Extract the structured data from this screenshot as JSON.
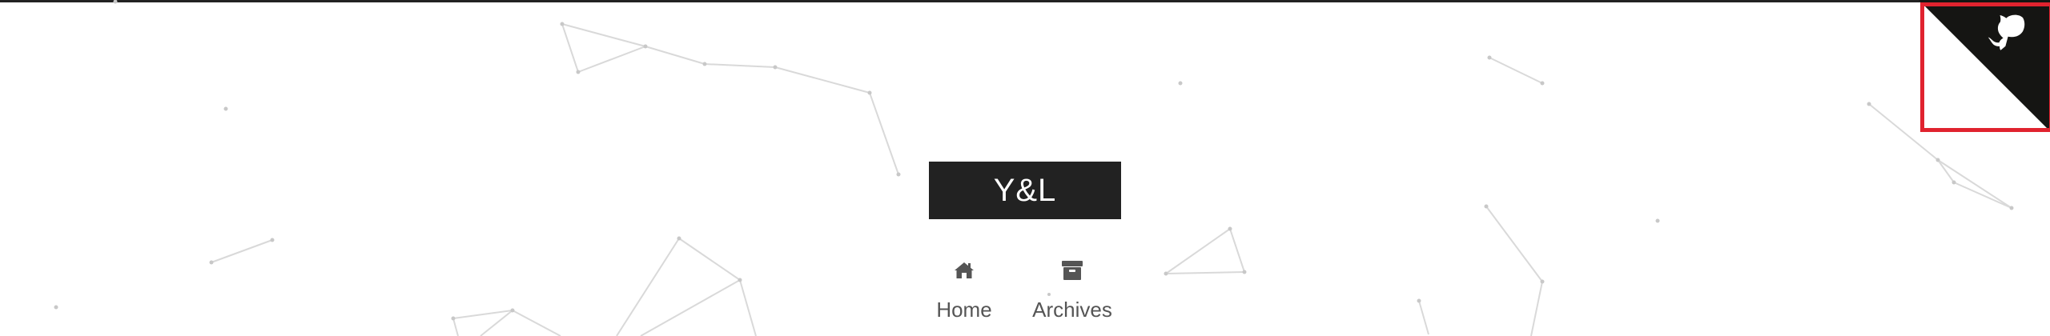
{
  "site": {
    "title": "Y&L"
  },
  "nav": {
    "items": [
      {
        "label": "Home",
        "icon": "home-icon"
      },
      {
        "label": "Archives",
        "icon": "archive-icon"
      }
    ]
  },
  "github_corner": {
    "icon": "github-octocat-icon",
    "highlighted": true,
    "highlight_color": "#e0232f"
  },
  "colors": {
    "brand_bg": "#222222",
    "brand_text": "#ffffff",
    "nav_text": "#555555",
    "background": "#ffffff"
  }
}
